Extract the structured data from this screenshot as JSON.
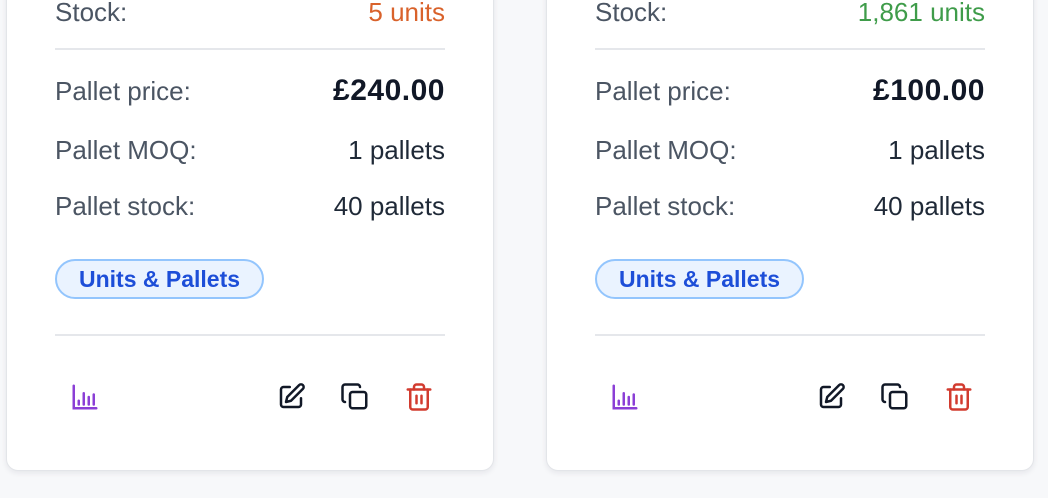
{
  "colors": {
    "stock_low": "#d9622b",
    "stock_ok": "#3f9c4a",
    "badge_text": "#1d4ed8",
    "chart_icon": "#8b3fd6",
    "delete_icon": "#d23b2f"
  },
  "cards": [
    {
      "stock_label": "Stock:",
      "stock_value": "5 units",
      "pallet_price_label": "Pallet price:",
      "pallet_price_value": "£240.00",
      "pallet_moq_label": "Pallet MOQ:",
      "pallet_moq_value": "1 pallets",
      "pallet_stock_label": "Pallet stock:",
      "pallet_stock_value": "40 pallets",
      "badge": "Units & Pallets",
      "actions": [
        "chart-icon",
        "edit-icon",
        "copy-icon",
        "trash-icon"
      ]
    },
    {
      "stock_label": "Stock:",
      "stock_value": "1,861 units",
      "pallet_price_label": "Pallet price:",
      "pallet_price_value": "£100.00",
      "pallet_moq_label": "Pallet MOQ:",
      "pallet_moq_value": "1 pallets",
      "pallet_stock_label": "Pallet stock:",
      "pallet_stock_value": "40 pallets",
      "badge": "Units & Pallets",
      "actions": [
        "chart-icon",
        "edit-icon",
        "copy-icon",
        "trash-icon"
      ]
    }
  ]
}
